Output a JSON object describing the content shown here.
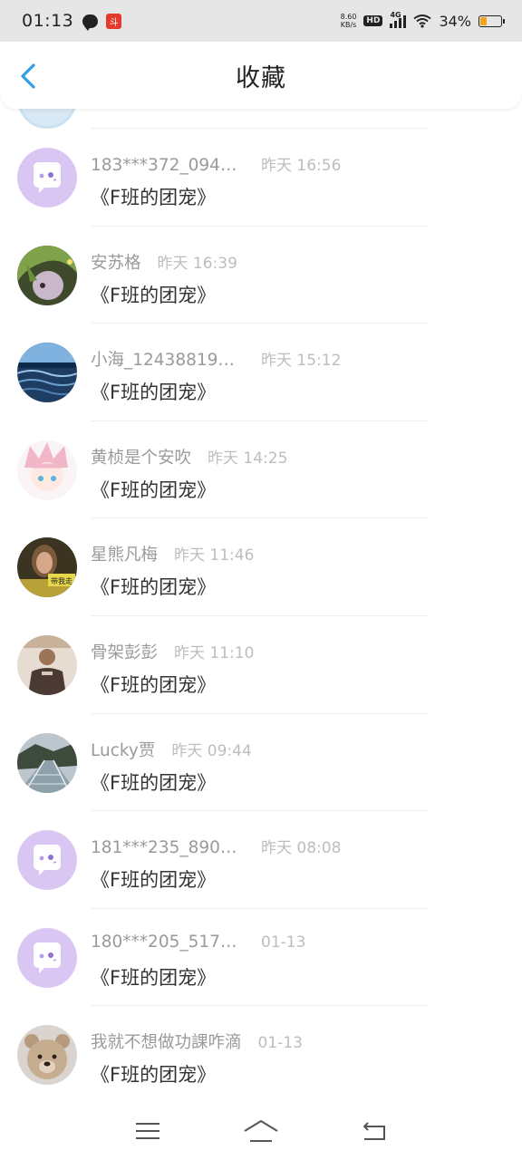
{
  "status_bar": {
    "time": "01:13",
    "net_speed": "8.60",
    "net_speed_unit": "KB/s",
    "hd": "HD",
    "network": "4G",
    "battery_percent": "34%",
    "battery_level": 0.34,
    "battery_color": "#f2a51a",
    "app_icon_text": "斗"
  },
  "header": {
    "title": "收藏",
    "back_icon": "chevron-left-icon",
    "accent_color": "#2f9fe6"
  },
  "items": [
    {
      "name": "183***372_0945…",
      "time": "昨天 16:56",
      "title": "《F班的团宠》",
      "avatar": "default-chat-avatar"
    },
    {
      "name": "安苏格",
      "time": "昨天 16:39",
      "title": "《F班的团宠》",
      "avatar": "anime-green-hair-avatar"
    },
    {
      "name": "小海_12438819…",
      "time": "昨天 15:12",
      "title": "《F班的团宠》",
      "avatar": "ocean-avatar"
    },
    {
      "name": "黄桢是个安吹",
      "time": "昨天 14:25",
      "title": "《F班的团宠》",
      "avatar": "anime-pink-hair-avatar"
    },
    {
      "name": "星熊凡梅",
      "time": "昨天 11:46",
      "title": "《F班的团宠》",
      "avatar": "photo-avatar",
      "avatar_text": "带我走"
    },
    {
      "name": "骨架彭彭",
      "time": "昨天 11:10",
      "title": "《F班的团宠》",
      "avatar": "person-photo-avatar"
    },
    {
      "name": "Lucky贾",
      "time": "昨天 09:44",
      "title": "《F班的团宠》",
      "avatar": "glass-bridge-avatar"
    },
    {
      "name": "181***235_8909…",
      "time": "昨天 08:08",
      "title": "《F班的团宠》",
      "avatar": "default-chat-avatar"
    },
    {
      "name": "180***205_5179…",
      "time": "01-13",
      "title": "《F班的团宠》",
      "avatar": "default-chat-avatar"
    },
    {
      "name": "我就不想做功課咋滴",
      "time": "01-13",
      "title": "《F班的团宠》",
      "avatar": "teddy-bear-avatar"
    }
  ],
  "nav": {
    "menu_icon": "menu-icon",
    "home_icon": "home-icon",
    "back_icon": "back-icon"
  }
}
